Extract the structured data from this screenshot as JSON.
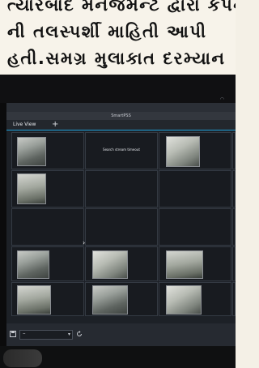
{
  "article": {
    "line1": "ત્યારબાદ મેનેજમેન્ટ દ્વારા કંપની",
    "line2": "ની તલસ્પર્શી માહિતી આપી",
    "line3": "હતી.સમગ્ર  મુલાકાત દરમ્યાન"
  },
  "app": {
    "title": "SmartPSS",
    "tab_label": "Live View",
    "add_tab": "+"
  },
  "grid": {
    "stream_message": "Search stream timeout"
  },
  "colors": {
    "tab_underline": "#1ea0d8",
    "screen_bg": "#1d2127"
  }
}
